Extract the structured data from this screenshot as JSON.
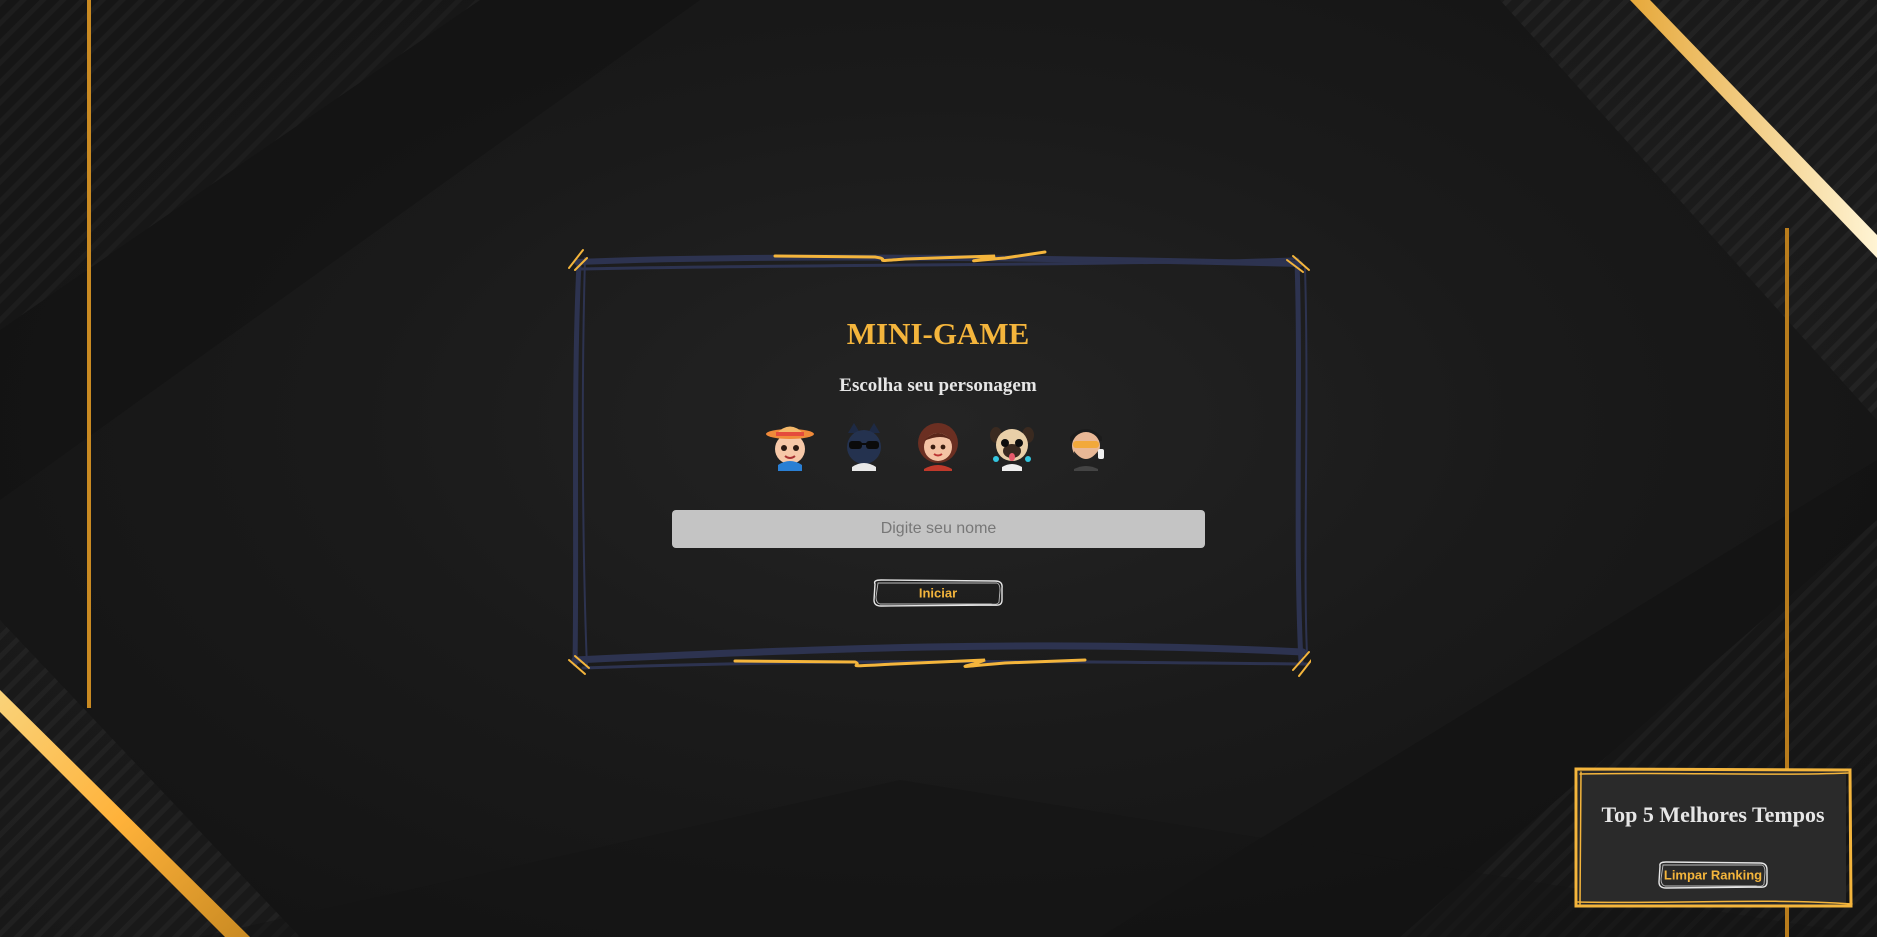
{
  "game": {
    "title": "MINI-GAME",
    "subtitle": "Escolha seu personagem"
  },
  "characters": [
    {
      "icon": "character-hat-boy-icon"
    },
    {
      "icon": "character-sunglasses-cat-icon"
    },
    {
      "icon": "character-brown-hair-woman-icon"
    },
    {
      "icon": "character-pug-dog-icon"
    },
    {
      "icon": "character-bearded-man-sunglasses-icon"
    }
  ],
  "name_input": {
    "placeholder": "Digite seu nome",
    "value": ""
  },
  "start_button": {
    "label": "Iniciar"
  },
  "ranking": {
    "title": "Top 5 Melhores Tempos",
    "clear_label": "Limpar Ranking"
  },
  "colors": {
    "accent": "#f4b53c",
    "frame": "#2d3350",
    "background": "#1a1a1a",
    "input_bg": "#c4c4c4"
  }
}
